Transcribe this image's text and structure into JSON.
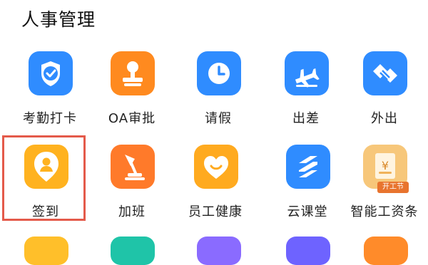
{
  "section": {
    "title": "人事管理"
  },
  "apps_row1": [
    {
      "label": "考勤打卡",
      "icon": "attendance-check-icon",
      "color": "#2f8cff"
    },
    {
      "label": "OA审批",
      "icon": "stamp-icon",
      "color": "#ff8a1f"
    },
    {
      "label": "请假",
      "icon": "clock-icon",
      "color": "#2f8cff"
    },
    {
      "label": "出差",
      "icon": "airplane-icon",
      "color": "#2f8cff"
    },
    {
      "label": "外出",
      "icon": "handshake-icon",
      "color": "#2f8cff"
    }
  ],
  "apps_row2": [
    {
      "label": "签到",
      "icon": "location-pin-person-icon",
      "color": "#ffb21f",
      "selected": true
    },
    {
      "label": "加班",
      "icon": "desk-lamp-icon",
      "color": "#ff7a2a"
    },
    {
      "label": "员工健康",
      "icon": "heart-icon",
      "color": "#ffaa1f"
    },
    {
      "label": "云课堂",
      "icon": "stacked-layers-icon",
      "color": "#2f8cff"
    },
    {
      "label": "智能工资条",
      "icon": "payslip-icon",
      "color": "#f7c77a",
      "badge": "开工节"
    }
  ],
  "payslip": {
    "symbol": "¥"
  }
}
